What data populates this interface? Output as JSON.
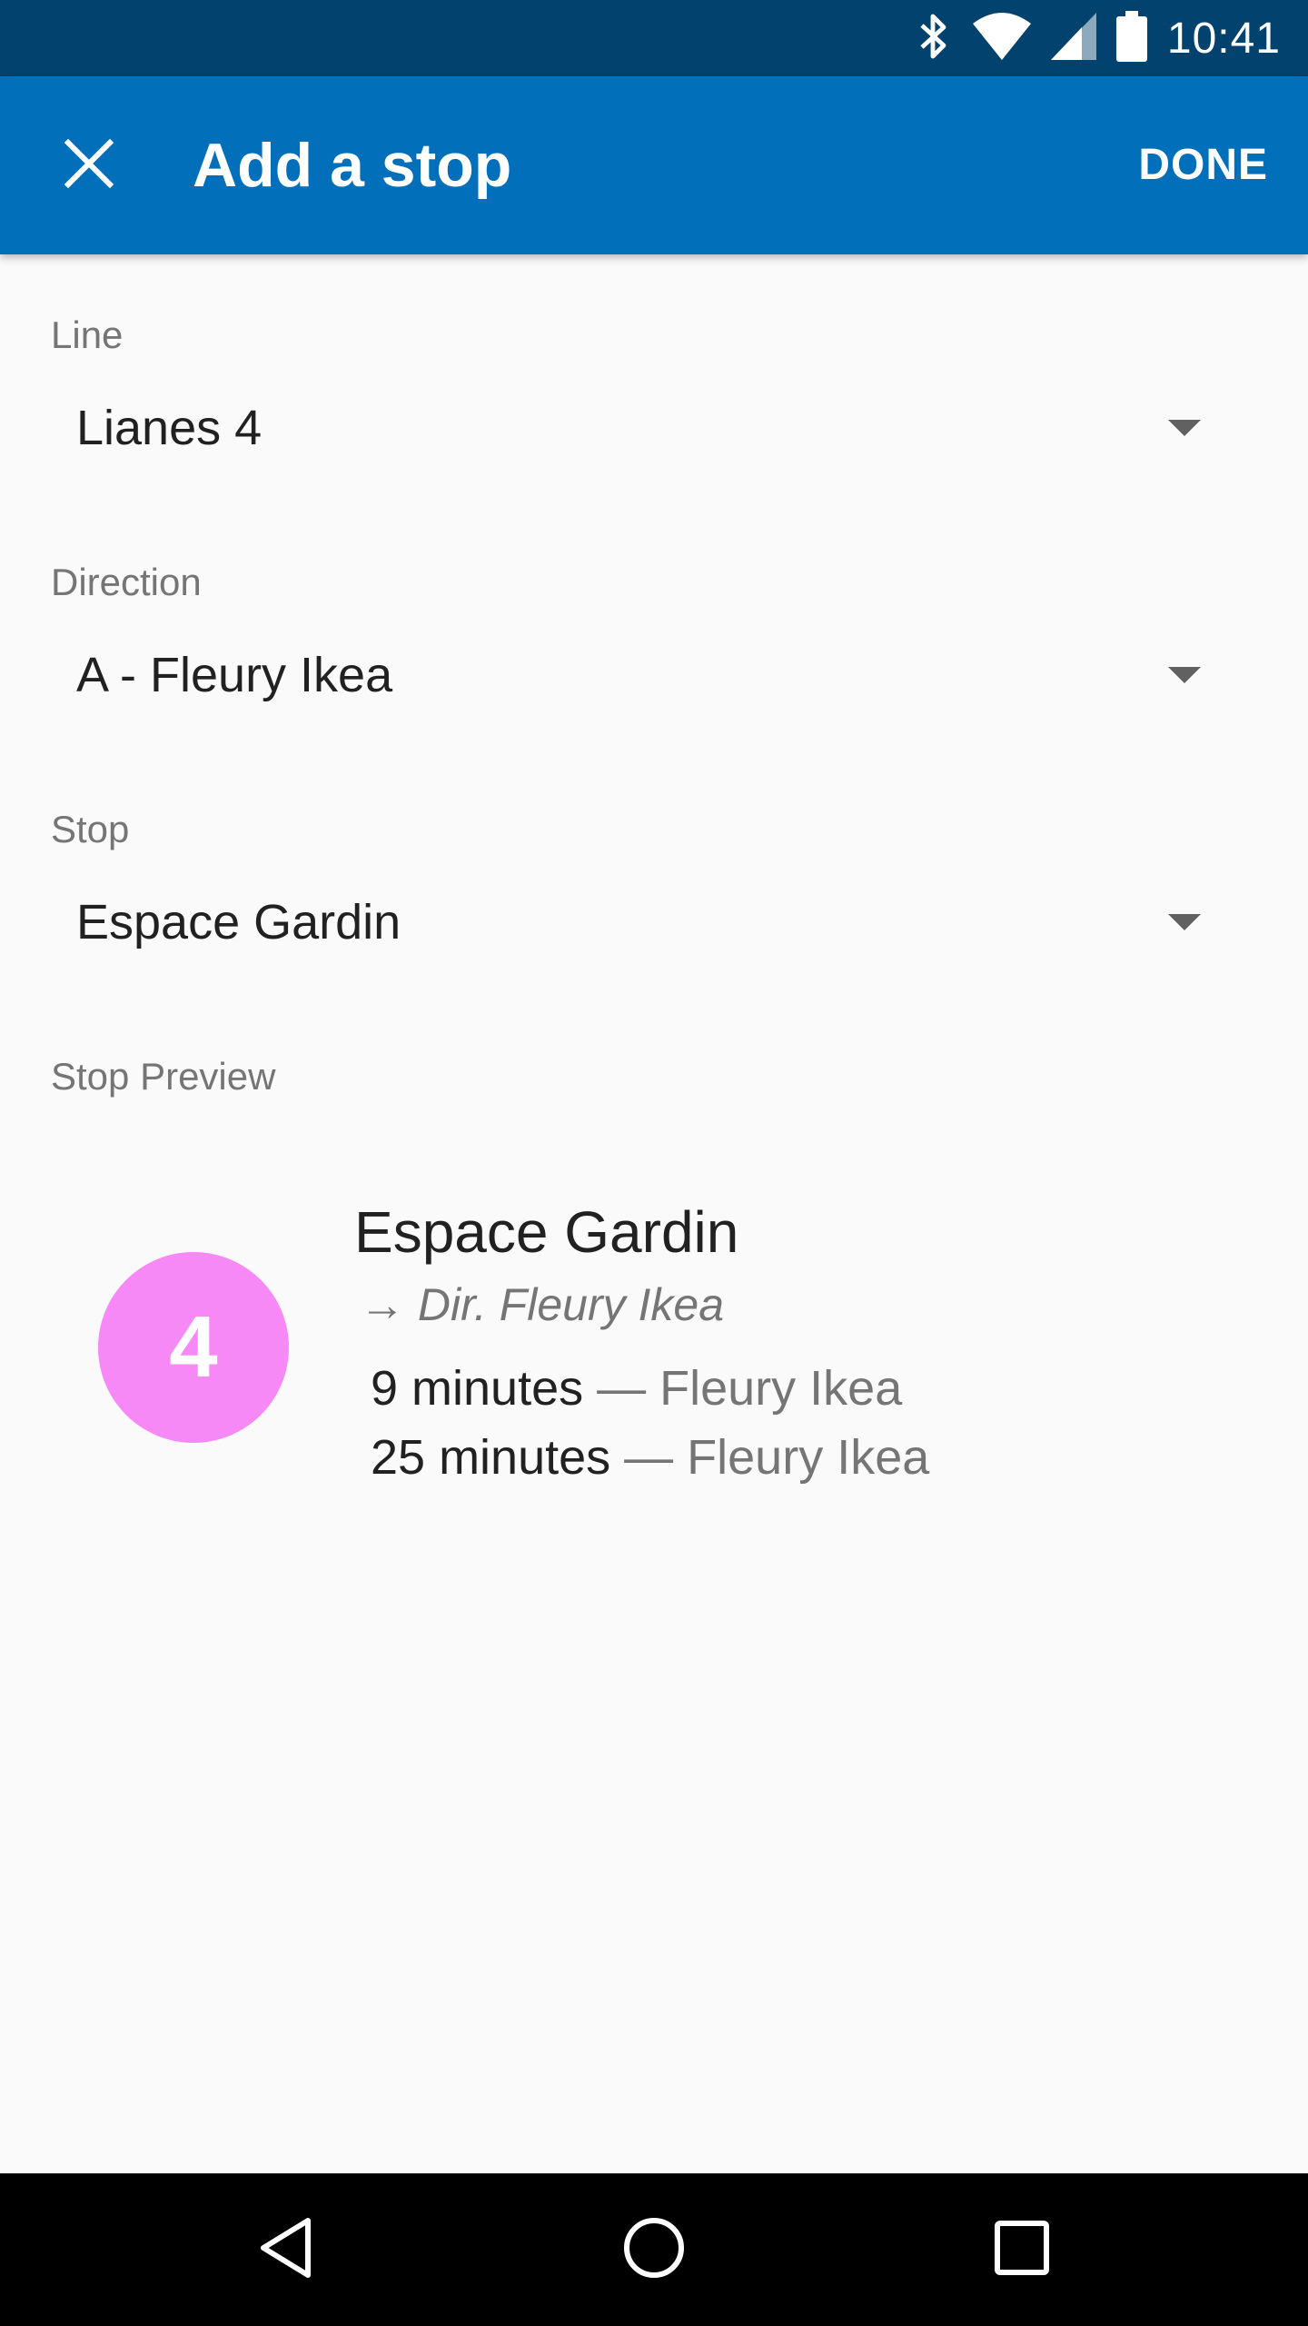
{
  "status_bar": {
    "time": "10:41",
    "icons": [
      "bluetooth-icon",
      "wifi-icon",
      "cell-signal-icon",
      "battery-icon"
    ]
  },
  "app_bar": {
    "title": "Add a stop",
    "done_label": "DONE",
    "close_icon": "close-icon"
  },
  "form": {
    "line": {
      "label": "Line",
      "value": "Lianes 4"
    },
    "direction": {
      "label": "Direction",
      "value": "A - Fleury Ikea"
    },
    "stop": {
      "label": "Stop",
      "value": "Espace Gardin"
    }
  },
  "preview": {
    "label": "Stop Preview",
    "line_number": "4",
    "line_color": "#f689f6",
    "stop_name": "Espace Gardin",
    "direction": "→ Dir. Fleury Ikea",
    "departures": [
      {
        "time": "9 minutes",
        "destination": " — Fleury Ikea"
      },
      {
        "time": "25 minutes",
        "destination": " — Fleury Ikea"
      }
    ]
  },
  "colors": {
    "status_bar": "#02426e",
    "app_bar": "#016fba",
    "background": "#fafafa"
  },
  "nav_bar": {
    "buttons": [
      "back-icon",
      "home-icon",
      "recents-icon"
    ]
  }
}
